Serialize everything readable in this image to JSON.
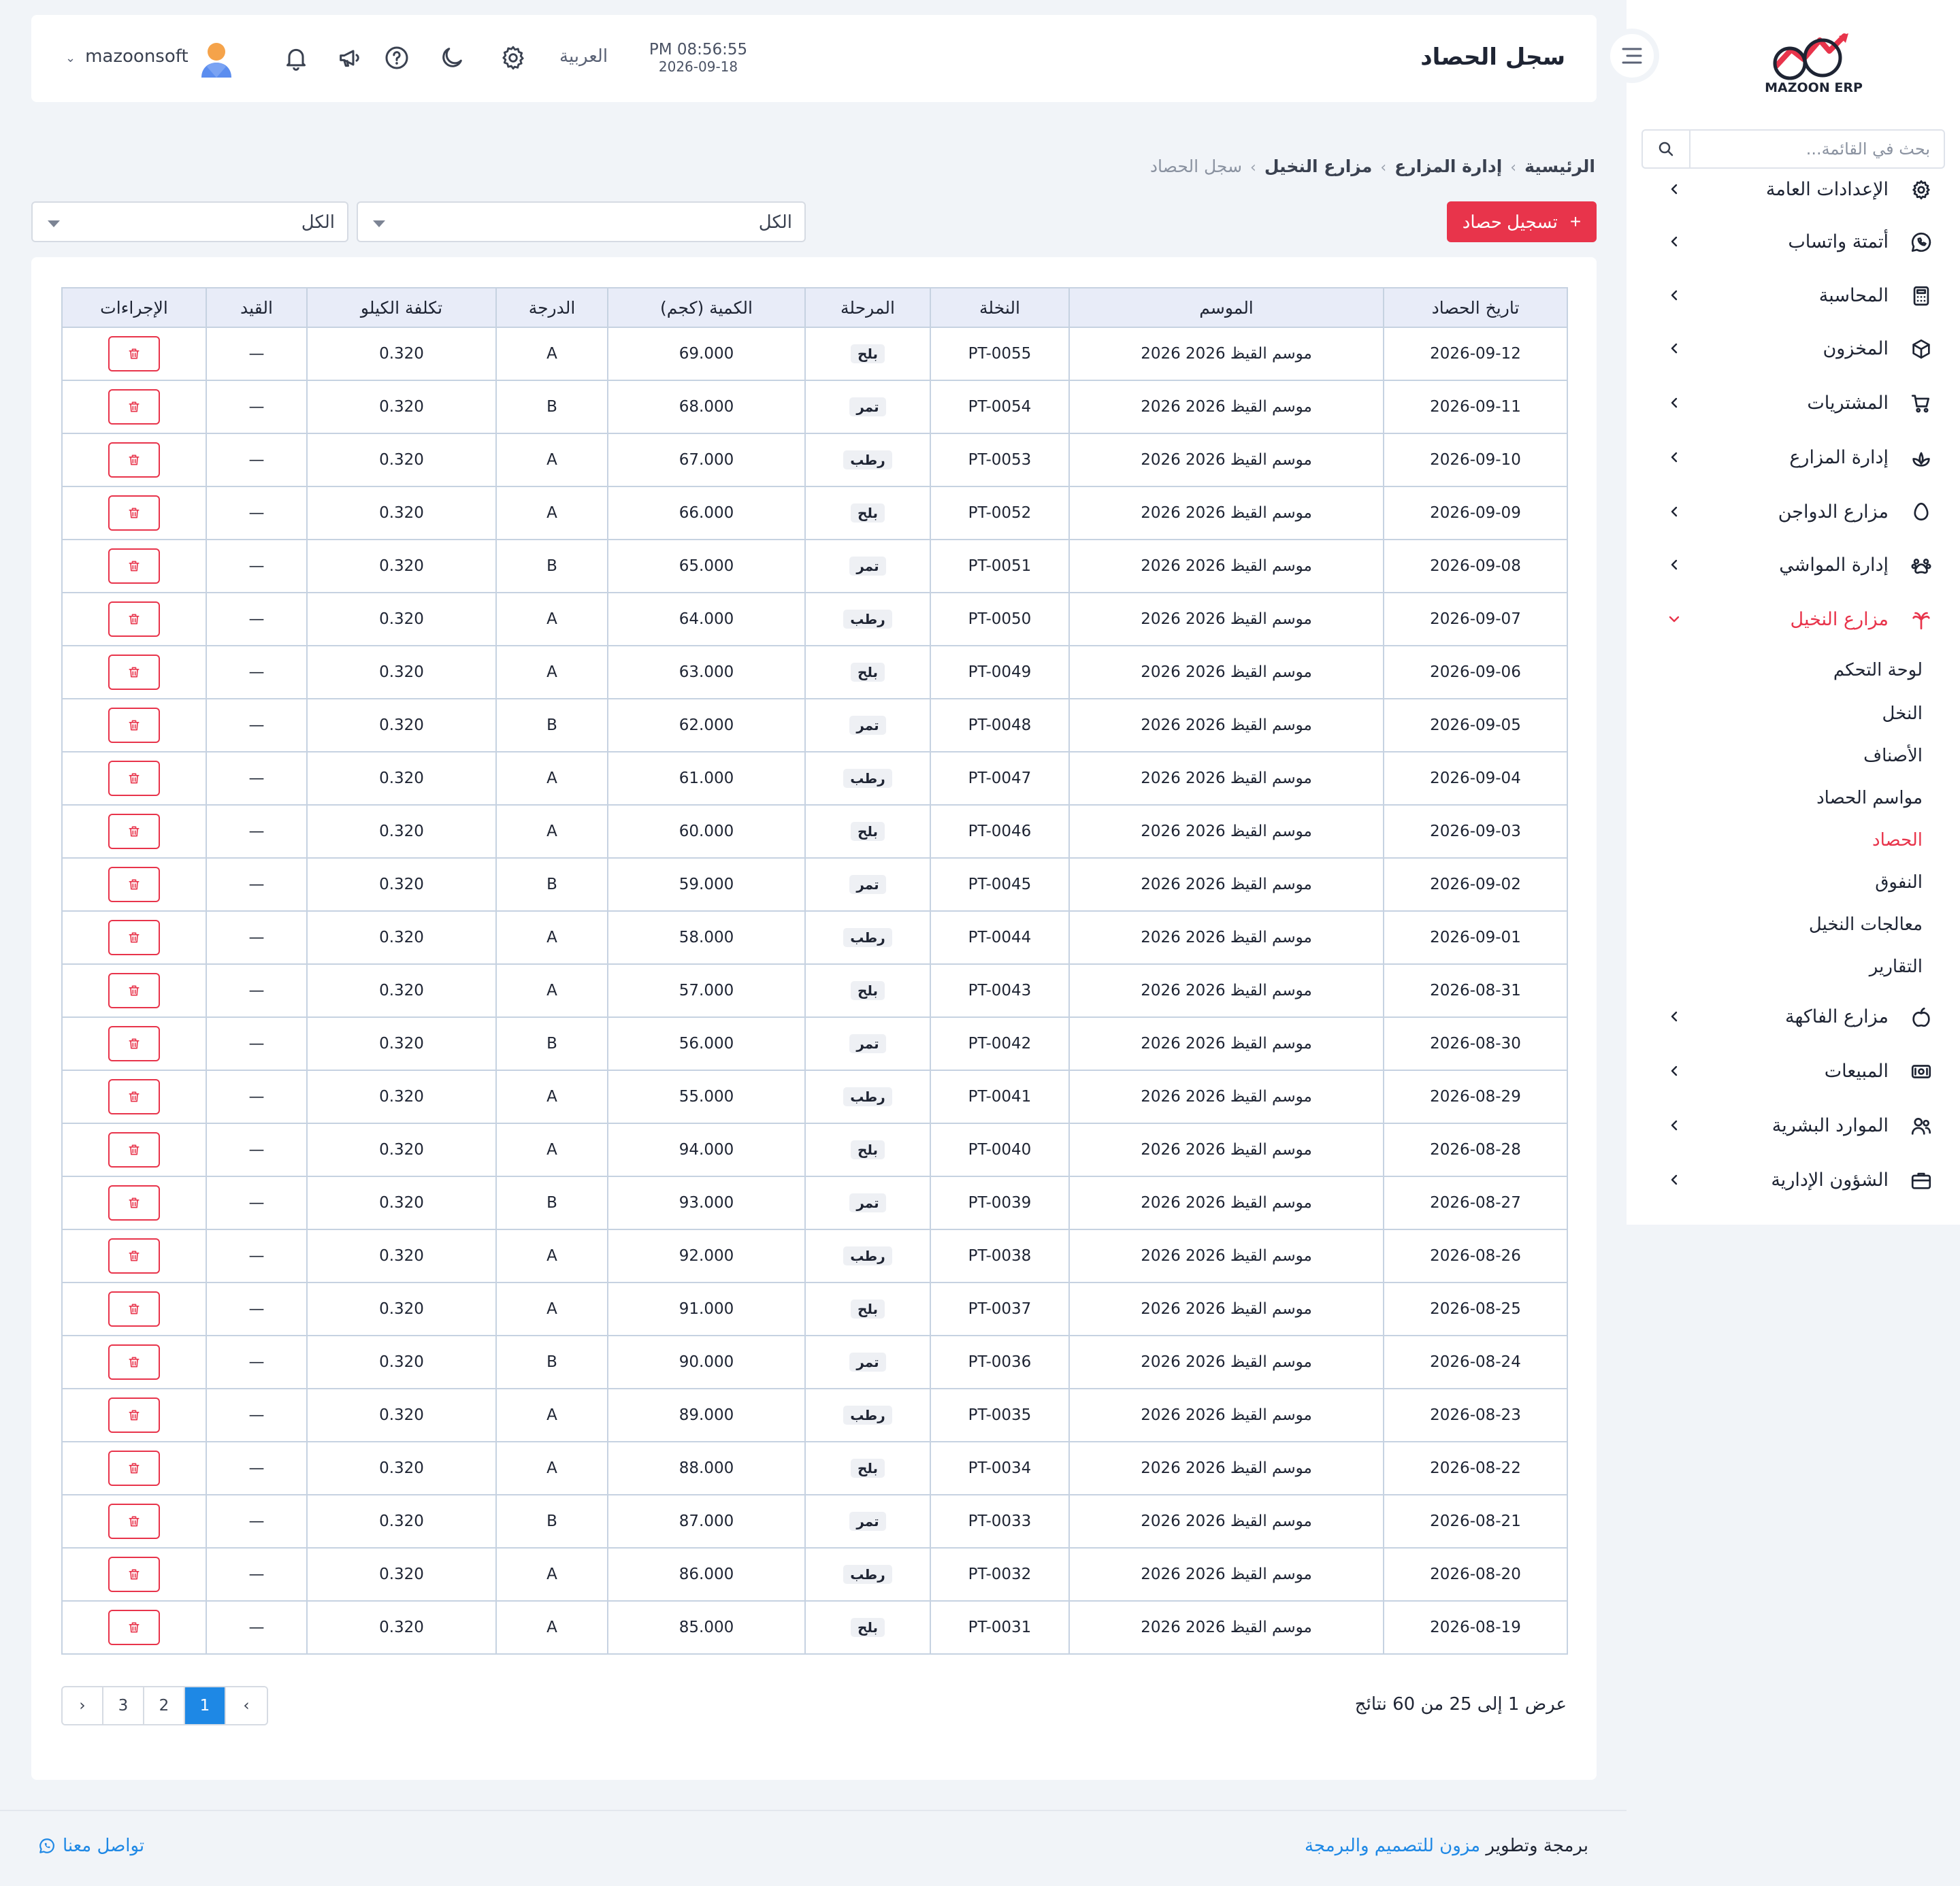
{
  "sidebar": {
    "logo_text": "MAZOON ERP",
    "search_placeholder": "بحث في القائمة...",
    "items": [
      {
        "label": "الإعدادات العامة",
        "icon": "gear-icon"
      },
      {
        "label": "أتمتة واتساب",
        "icon": "whatsapp-icon"
      },
      {
        "label": "المحاسبة",
        "icon": "calculator-icon"
      },
      {
        "label": "المخزون",
        "icon": "box-icon"
      },
      {
        "label": "المشتريات",
        "icon": "cart-icon"
      },
      {
        "label": "إدارة المزارع",
        "icon": "plant-icon"
      },
      {
        "label": "مزارع الدواجن",
        "icon": "egg-icon"
      },
      {
        "label": "إدارة المواشي",
        "icon": "paw-icon"
      },
      {
        "label": "مزارع النخيل",
        "icon": "palm-icon"
      },
      {
        "label": "مزارع الفاكهة",
        "icon": "fruit-icon"
      },
      {
        "label": "المبيعات",
        "icon": "cash-icon"
      },
      {
        "label": "الموارد البشرية",
        "icon": "users-icon"
      },
      {
        "label": "الشؤون الإدارية",
        "icon": "briefcase-icon"
      }
    ],
    "submenu": [
      "لوحة التحكم",
      "النخل",
      "الأصناف",
      "مواسم الحصاد",
      "الحصاد",
      "النفوق",
      "معالجات النخيل",
      "التقارير"
    ],
    "active_item": "مزارع النخيل",
    "active_sub": "الحصاد"
  },
  "header": {
    "title": "سجل الحصاد",
    "time": "PM 08:56:55",
    "date": "2026-09-18",
    "language": "العربية",
    "username": "mazoonsoft"
  },
  "breadcrumb": [
    "الرئيسية",
    "إدارة المزارع",
    "مزارع النخيل",
    "سجل الحصاد"
  ],
  "toolbar": {
    "add_label": "تسجيل حصاد",
    "filter1_value": "الكل",
    "filter2_value": "الكل"
  },
  "table": {
    "columns": [
      "تاريخ الحصاد",
      "الموسم",
      "النخلة",
      "المرحلة",
      "الكمية (كجم)",
      "الدرجة",
      "تكلفة الكيلو",
      "القيد",
      "الإجراءات"
    ],
    "rows": [
      {
        "date": "2026-09-12",
        "season": "موسم القيظ 2026 2026",
        "palm": "PT-0055",
        "stage": "بلح",
        "qty": "69.000",
        "grade": "A",
        "cost": "0.320",
        "entry": "—"
      },
      {
        "date": "2026-09-11",
        "season": "موسم القيظ 2026 2026",
        "palm": "PT-0054",
        "stage": "تمر",
        "qty": "68.000",
        "grade": "B",
        "cost": "0.320",
        "entry": "—"
      },
      {
        "date": "2026-09-10",
        "season": "موسم القيظ 2026 2026",
        "palm": "PT-0053",
        "stage": "رطب",
        "qty": "67.000",
        "grade": "A",
        "cost": "0.320",
        "entry": "—"
      },
      {
        "date": "2026-09-09",
        "season": "موسم القيظ 2026 2026",
        "palm": "PT-0052",
        "stage": "بلح",
        "qty": "66.000",
        "grade": "A",
        "cost": "0.320",
        "entry": "—"
      },
      {
        "date": "2026-09-08",
        "season": "موسم القيظ 2026 2026",
        "palm": "PT-0051",
        "stage": "تمر",
        "qty": "65.000",
        "grade": "B",
        "cost": "0.320",
        "entry": "—"
      },
      {
        "date": "2026-09-07",
        "season": "موسم القيظ 2026 2026",
        "palm": "PT-0050",
        "stage": "رطب",
        "qty": "64.000",
        "grade": "A",
        "cost": "0.320",
        "entry": "—"
      },
      {
        "date": "2026-09-06",
        "season": "موسم القيظ 2026 2026",
        "palm": "PT-0049",
        "stage": "بلح",
        "qty": "63.000",
        "grade": "A",
        "cost": "0.320",
        "entry": "—"
      },
      {
        "date": "2026-09-05",
        "season": "موسم القيظ 2026 2026",
        "palm": "PT-0048",
        "stage": "تمر",
        "qty": "62.000",
        "grade": "B",
        "cost": "0.320",
        "entry": "—"
      },
      {
        "date": "2026-09-04",
        "season": "موسم القيظ 2026 2026",
        "palm": "PT-0047",
        "stage": "رطب",
        "qty": "61.000",
        "grade": "A",
        "cost": "0.320",
        "entry": "—"
      },
      {
        "date": "2026-09-03",
        "season": "موسم القيظ 2026 2026",
        "palm": "PT-0046",
        "stage": "بلح",
        "qty": "60.000",
        "grade": "A",
        "cost": "0.320",
        "entry": "—"
      },
      {
        "date": "2026-09-02",
        "season": "موسم القيظ 2026 2026",
        "palm": "PT-0045",
        "stage": "تمر",
        "qty": "59.000",
        "grade": "B",
        "cost": "0.320",
        "entry": "—"
      },
      {
        "date": "2026-09-01",
        "season": "موسم القيظ 2026 2026",
        "palm": "PT-0044",
        "stage": "رطب",
        "qty": "58.000",
        "grade": "A",
        "cost": "0.320",
        "entry": "—"
      },
      {
        "date": "2026-08-31",
        "season": "موسم القيظ 2026 2026",
        "palm": "PT-0043",
        "stage": "بلح",
        "qty": "57.000",
        "grade": "A",
        "cost": "0.320",
        "entry": "—"
      },
      {
        "date": "2026-08-30",
        "season": "موسم القيظ 2026 2026",
        "palm": "PT-0042",
        "stage": "تمر",
        "qty": "56.000",
        "grade": "B",
        "cost": "0.320",
        "entry": "—"
      },
      {
        "date": "2026-08-29",
        "season": "موسم القيظ 2026 2026",
        "palm": "PT-0041",
        "stage": "رطب",
        "qty": "55.000",
        "grade": "A",
        "cost": "0.320",
        "entry": "—"
      },
      {
        "date": "2026-08-28",
        "season": "موسم القيظ 2026 2026",
        "palm": "PT-0040",
        "stage": "بلح",
        "qty": "94.000",
        "grade": "A",
        "cost": "0.320",
        "entry": "—"
      },
      {
        "date": "2026-08-27",
        "season": "موسم القيظ 2026 2026",
        "palm": "PT-0039",
        "stage": "تمر",
        "qty": "93.000",
        "grade": "B",
        "cost": "0.320",
        "entry": "—"
      },
      {
        "date": "2026-08-26",
        "season": "موسم القيظ 2026 2026",
        "palm": "PT-0038",
        "stage": "رطب",
        "qty": "92.000",
        "grade": "A",
        "cost": "0.320",
        "entry": "—"
      },
      {
        "date": "2026-08-25",
        "season": "موسم القيظ 2026 2026",
        "palm": "PT-0037",
        "stage": "بلح",
        "qty": "91.000",
        "grade": "A",
        "cost": "0.320",
        "entry": "—"
      },
      {
        "date": "2026-08-24",
        "season": "موسم القيظ 2026 2026",
        "palm": "PT-0036",
        "stage": "تمر",
        "qty": "90.000",
        "grade": "B",
        "cost": "0.320",
        "entry": "—"
      },
      {
        "date": "2026-08-23",
        "season": "موسم القيظ 2026 2026",
        "palm": "PT-0035",
        "stage": "رطب",
        "qty": "89.000",
        "grade": "A",
        "cost": "0.320",
        "entry": "—"
      },
      {
        "date": "2026-08-22",
        "season": "موسم القيظ 2026 2026",
        "palm": "PT-0034",
        "stage": "بلح",
        "qty": "88.000",
        "grade": "A",
        "cost": "0.320",
        "entry": "—"
      },
      {
        "date": "2026-08-21",
        "season": "موسم القيظ 2026 2026",
        "palm": "PT-0033",
        "stage": "تمر",
        "qty": "87.000",
        "grade": "B",
        "cost": "0.320",
        "entry": "—"
      },
      {
        "date": "2026-08-20",
        "season": "موسم القيظ 2026 2026",
        "palm": "PT-0032",
        "stage": "رطب",
        "qty": "86.000",
        "grade": "A",
        "cost": "0.320",
        "entry": "—"
      },
      {
        "date": "2026-08-19",
        "season": "موسم القيظ 2026 2026",
        "palm": "PT-0031",
        "stage": "بلح",
        "qty": "85.000",
        "grade": "A",
        "cost": "0.320",
        "entry": "—"
      }
    ]
  },
  "pagination": {
    "info": "عرض 1 إلى 25 من 60 نتائج",
    "prev": "‹",
    "next": "›",
    "pages": [
      "1",
      "2",
      "3"
    ],
    "current": "1"
  },
  "footer": {
    "credit_prefix": "برمجة وتطوير",
    "credit_link": "مزون للتصميم والبرمجة",
    "contact": "تواصل معنا"
  },
  "colors": {
    "accent": "#e8344b",
    "link": "#1e88e5",
    "page_bg": "#f1f4f8",
    "table_header_bg": "#e8ecf8"
  }
}
